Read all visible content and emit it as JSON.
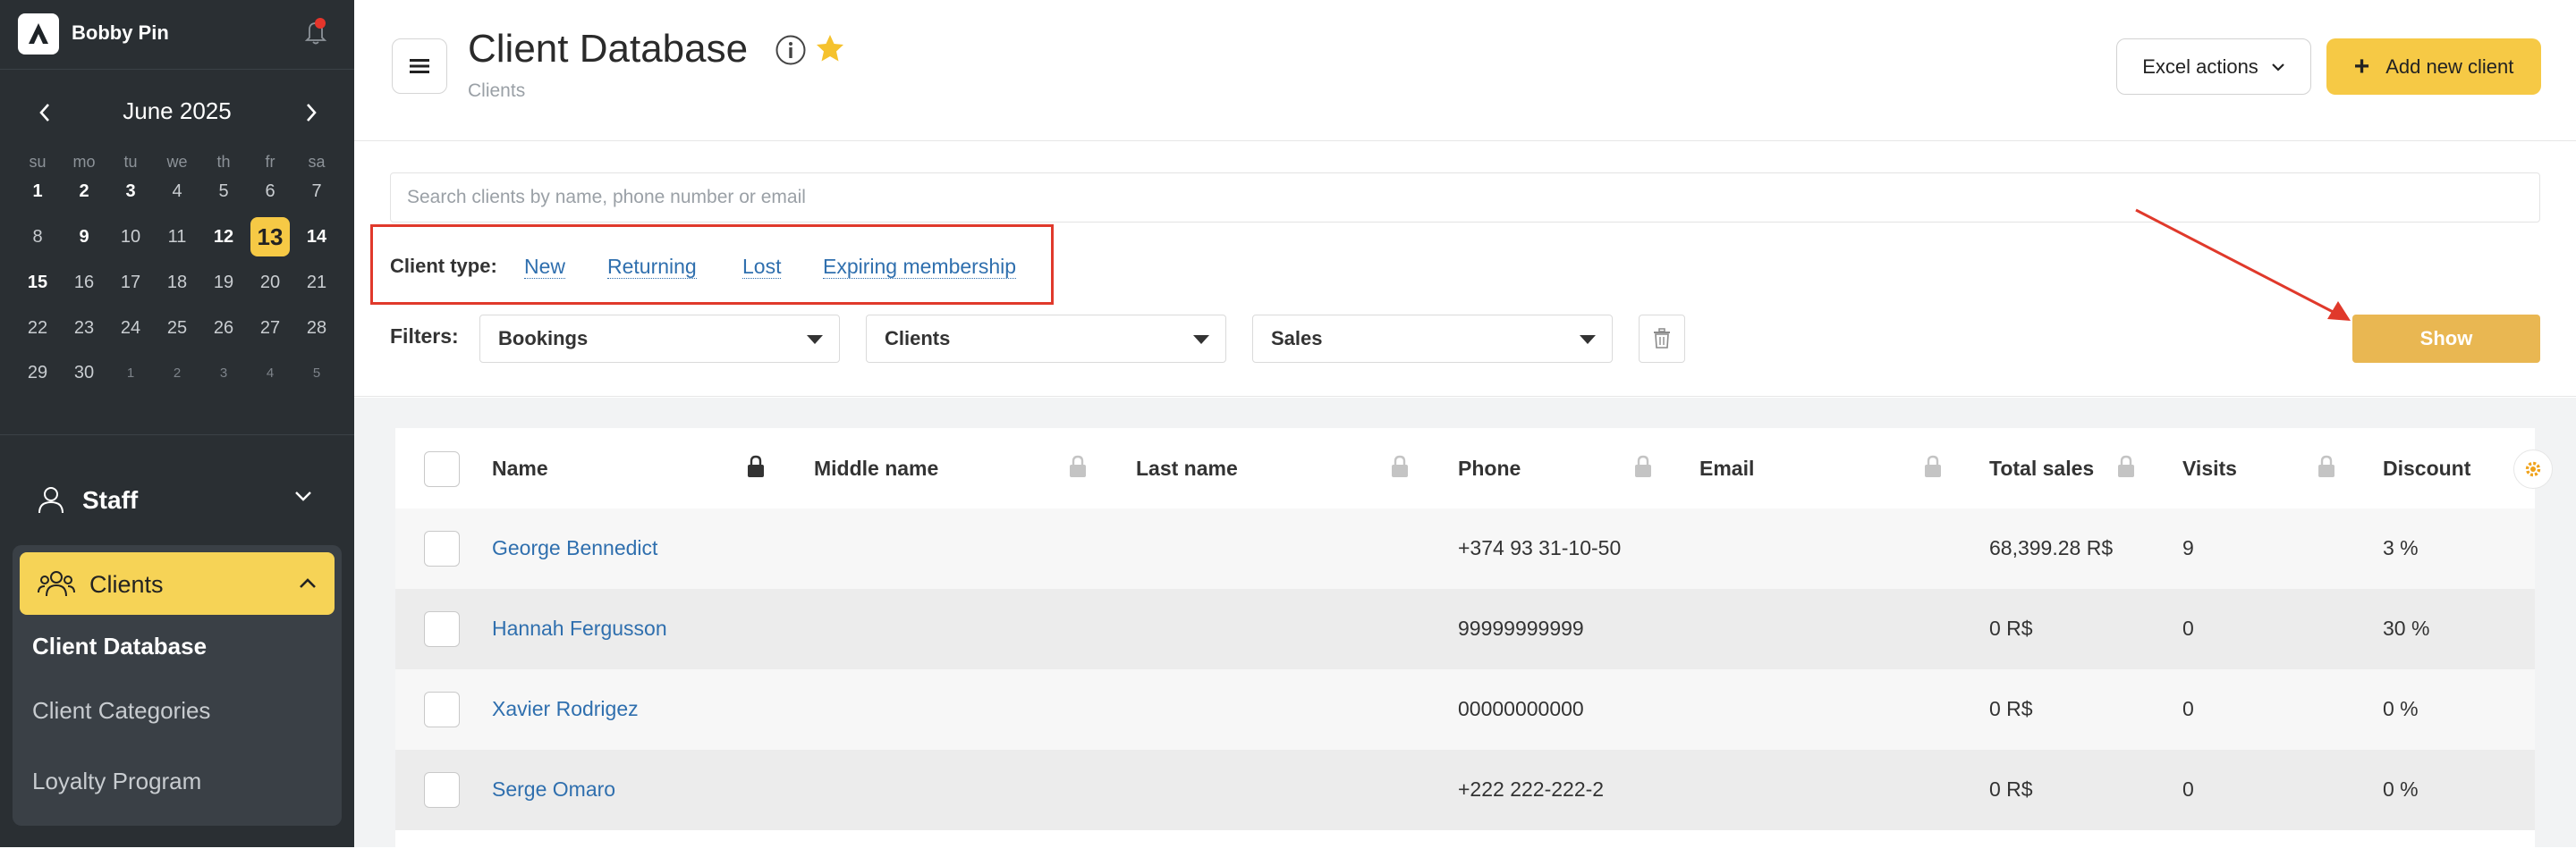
{
  "sidebar": {
    "user_name": "Bobby Pin",
    "calendar": {
      "month_label": "June 2025",
      "weekdays": [
        "su",
        "mo",
        "tu",
        "we",
        "th",
        "fr",
        "sa"
      ],
      "weeks": [
        [
          "1",
          "2",
          "3",
          "4",
          "5",
          "6",
          "7"
        ],
        [
          "8",
          "9",
          "10",
          "11",
          "12",
          "13",
          "14"
        ],
        [
          "15",
          "16",
          "17",
          "18",
          "19",
          "20",
          "21"
        ],
        [
          "22",
          "23",
          "24",
          "25",
          "26",
          "27",
          "28"
        ],
        [
          "29",
          "30",
          "1",
          "2",
          "3",
          "4",
          "5"
        ]
      ],
      "today": "13"
    },
    "nav": {
      "staff_label": "Staff",
      "clients_label": "Clients",
      "clients_sub": [
        "Client Database",
        "Client Categories",
        "Loyalty Program"
      ]
    }
  },
  "header": {
    "title": "Client Database",
    "breadcrumb": "Clients",
    "excel_label": "Excel actions",
    "add_label": "Add new client",
    "accent": "#f6c945"
  },
  "filters": {
    "search_placeholder": "Search clients by name, phone number or email",
    "client_type_label": "Client type:",
    "client_types": [
      "New",
      "Returning",
      "Lost",
      "Expiring membership"
    ],
    "filters_label": "Filters:",
    "selects": [
      "Bookings",
      "Clients",
      "Sales"
    ],
    "show_label": "Show"
  },
  "table": {
    "columns": [
      "Name",
      "Middle name",
      "Last name",
      "Phone",
      "Email",
      "Total sales",
      "Visits",
      "Discount"
    ],
    "rows": [
      {
        "name": "George Bennedict",
        "middle": "",
        "last": "",
        "phone": "+374 93 31-10-50",
        "email": "",
        "total": "68,399.28 R$",
        "visits": "9",
        "discount": "3 %"
      },
      {
        "name": "Hannah Fergusson",
        "middle": "",
        "last": "",
        "phone": "99999999999",
        "email": "",
        "total": "0 R$",
        "visits": "0",
        "discount": "30 %"
      },
      {
        "name": "Xavier Rodrigez",
        "middle": "",
        "last": "",
        "phone": "00000000000",
        "email": "",
        "total": "0 R$",
        "visits": "0",
        "discount": "0 %"
      },
      {
        "name": "Serge Omaro",
        "middle": "",
        "last": "",
        "phone": "+222 222-222-2",
        "email": "",
        "total": "0 R$",
        "visits": "0",
        "discount": "0 %"
      }
    ]
  }
}
